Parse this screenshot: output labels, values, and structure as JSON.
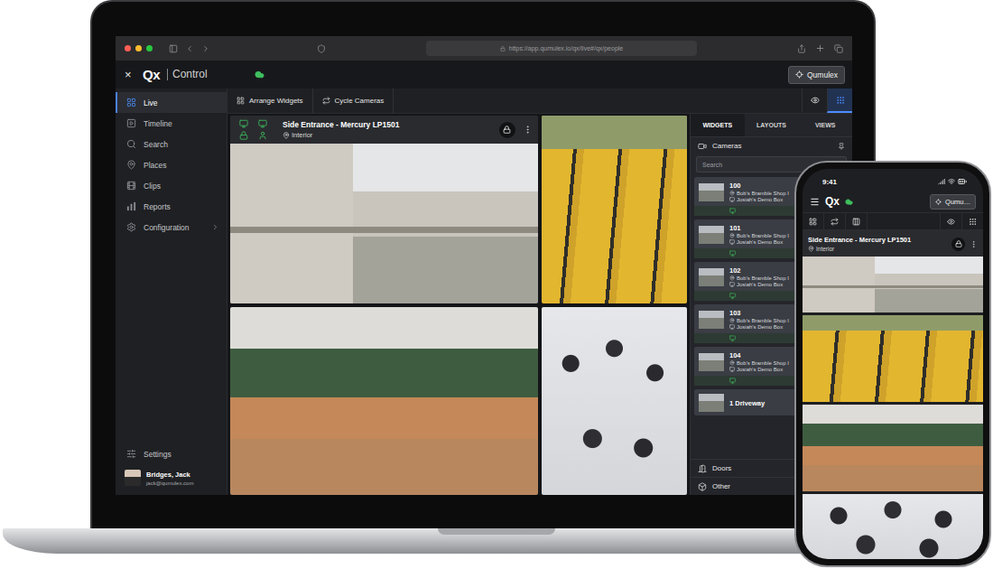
{
  "browser": {
    "url": "https://app.qumulex.io/qx/live#/qx/people"
  },
  "app": {
    "close": "×",
    "logo": "Qx",
    "product": "Control",
    "account_button": "Qumulex"
  },
  "sidebar": {
    "items": [
      {
        "label": "Live",
        "selected": true,
        "has_submenu": false,
        "kind": "live"
      },
      {
        "label": "Timeline",
        "selected": false,
        "has_submenu": false,
        "kind": "timeline"
      },
      {
        "label": "Search",
        "selected": false,
        "has_submenu": false,
        "kind": "search"
      },
      {
        "label": "Places",
        "selected": false,
        "has_submenu": false,
        "kind": "places"
      },
      {
        "label": "Clips",
        "selected": false,
        "has_submenu": false,
        "kind": "clips"
      },
      {
        "label": "Reports",
        "selected": false,
        "has_submenu": false,
        "kind": "reports"
      },
      {
        "label": "Configuration",
        "selected": false,
        "has_submenu": true,
        "kind": "configuration"
      }
    ],
    "settings": "Settings",
    "user": {
      "name": "Bridges, Jack",
      "email": "jack@qumulex.com"
    }
  },
  "toolbar": {
    "buttons": [
      {
        "label": "Arrange Widgets",
        "kind": "arrange"
      },
      {
        "label": "Cycle Cameras",
        "kind": "cycle"
      }
    ],
    "view_toggle": [
      {
        "kind": "eye",
        "selected": false
      },
      {
        "kind": "grid",
        "selected": true
      }
    ]
  },
  "featured_camera": {
    "title": "Side Entrance - Mercury LP1501",
    "location": "Interior",
    "locked": true
  },
  "panel": {
    "tabs": [
      {
        "label": "WIDGETS",
        "selected": true
      },
      {
        "label": "LAYOUTS",
        "selected": false
      },
      {
        "label": "VIEWS",
        "selected": false
      }
    ],
    "sections": [
      {
        "label": "Cameras",
        "expanded": true,
        "kind": "camera"
      },
      {
        "label": "Doors",
        "expanded": false,
        "kind": "door"
      },
      {
        "label": "Other",
        "expanded": false,
        "kind": "other"
      }
    ],
    "search_placeholder": "Search",
    "cameras": [
      {
        "name": "100",
        "site": "Bob's Bramble Shop I",
        "device": "Josiah's Demo Box"
      },
      {
        "name": "101",
        "site": "Bob's Bramble Shop I",
        "device": "Josiah's Demo Box"
      },
      {
        "name": "102",
        "site": "Bob's Bramble Shop I",
        "device": "Josiah's Demo Box"
      },
      {
        "name": "103",
        "site": "Bob's Bramble Shop I",
        "device": "Josiah's Demo Box"
      },
      {
        "name": "104",
        "site": "Bob's Bramble Shop I",
        "device": "Josiah's Demo Box"
      },
      {
        "name": "1 Driveway"
      }
    ]
  },
  "phone": {
    "time": "9:41",
    "logo": "Qx",
    "account_button": "Qumu…",
    "camera": {
      "title": "Side Entrance - Mercury LP1501",
      "location": "Interior",
      "locked": true
    },
    "view_toggle": [
      {
        "kind": "eye",
        "selected": false
      },
      {
        "kind": "grid",
        "selected": false
      }
    ]
  }
}
